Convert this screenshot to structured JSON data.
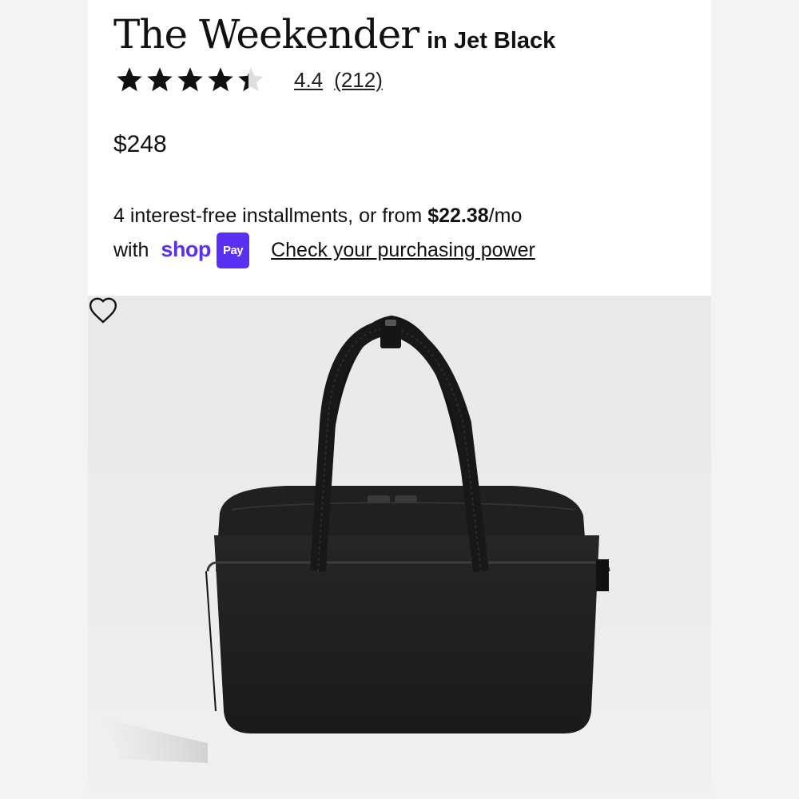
{
  "product": {
    "name": "The Weekender",
    "variant": "in Jet Black",
    "rating": 4.4,
    "rating_text": "4.4",
    "review_count": "(212)",
    "stars_total": 5,
    "price": "$248"
  },
  "installments": {
    "line1_text": "4 interest-free installments, or from ",
    "amount": "$22.38",
    "per": "/mo",
    "with_text": "with",
    "shop_text": "shop",
    "pay_text": "Pay",
    "link_text": "Check your purchasing power"
  },
  "colors": {
    "shop_brand": "#5a31f4",
    "text": "#111111",
    "bag": "#1e1e1e"
  },
  "icons": {
    "wishlist": "heart-icon",
    "rating": "star-icon"
  }
}
